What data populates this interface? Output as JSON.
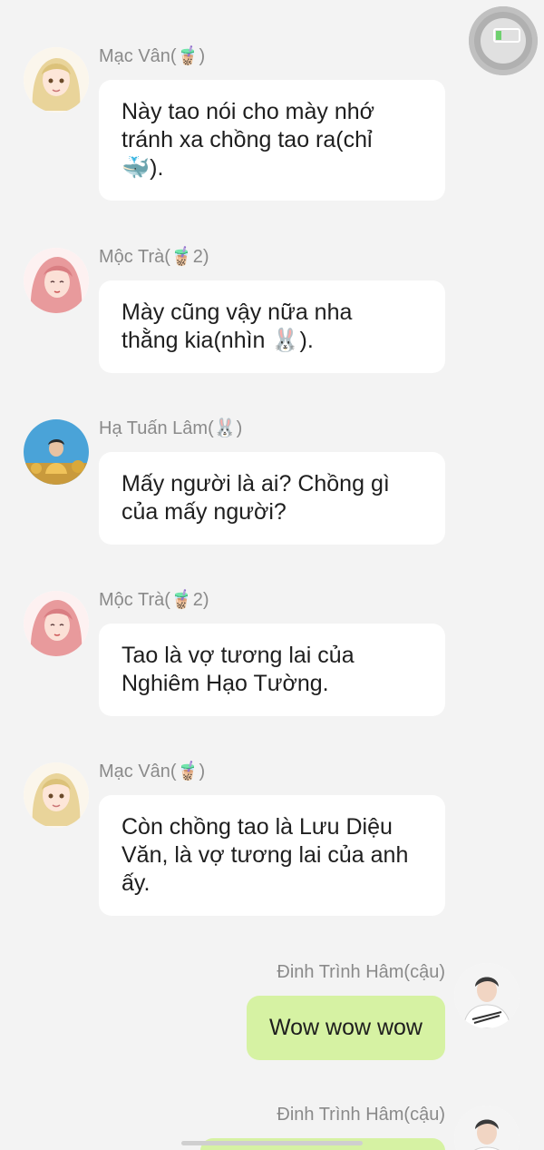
{
  "messages": [
    {
      "sender": "Mạc Vân(🧋)",
      "text": "Này tao nói cho mày nhớ\ntránh xa chồng tao ra(chỉ\n🐳).",
      "avatar": "blonde-anime-girl-avatar",
      "side": "left"
    },
    {
      "sender": "Mộc Trà(🧋2)",
      "text": "Mày cũng vậy nữa nha\nthằng kia(nhìn 🐰).",
      "avatar": "pink-hair-girl-avatar",
      "side": "left"
    },
    {
      "sender": "Hạ Tuấn Lâm(🐰)",
      "text": "Mấy người là ai? Chồng gì\ncủa mấy người?",
      "avatar": "boy-sky-photo-avatar",
      "side": "left"
    },
    {
      "sender": "Mộc Trà(🧋2)",
      "text": "Tao là vợ tương lai của\nNghiêm Hạo Tường.",
      "avatar": "pink-hair-girl-avatar",
      "side": "left"
    },
    {
      "sender": "Mạc Vân(🧋)",
      "text": "Còn chồng tao là Lưu Diệu\nVăn, là vợ tương lai của anh\nấy.",
      "avatar": "blonde-anime-girl-avatar",
      "side": "left"
    },
    {
      "sender": "Đinh Trình Hâm(cậu)",
      "text": "Wow wow wow",
      "avatar": "boy-white-sweater-avatar",
      "side": "right"
    },
    {
      "sender": "Đinh Trình Hâm(cậu)",
      "text": "",
      "avatar": "boy-white-sweater-avatar",
      "side": "right"
    }
  ],
  "colors": {
    "background": "#f3f3f3",
    "incoming_bubble": "#ffffff",
    "outgoing_bubble": "#d6f2a3",
    "sender_name": "#8a8a8a"
  }
}
